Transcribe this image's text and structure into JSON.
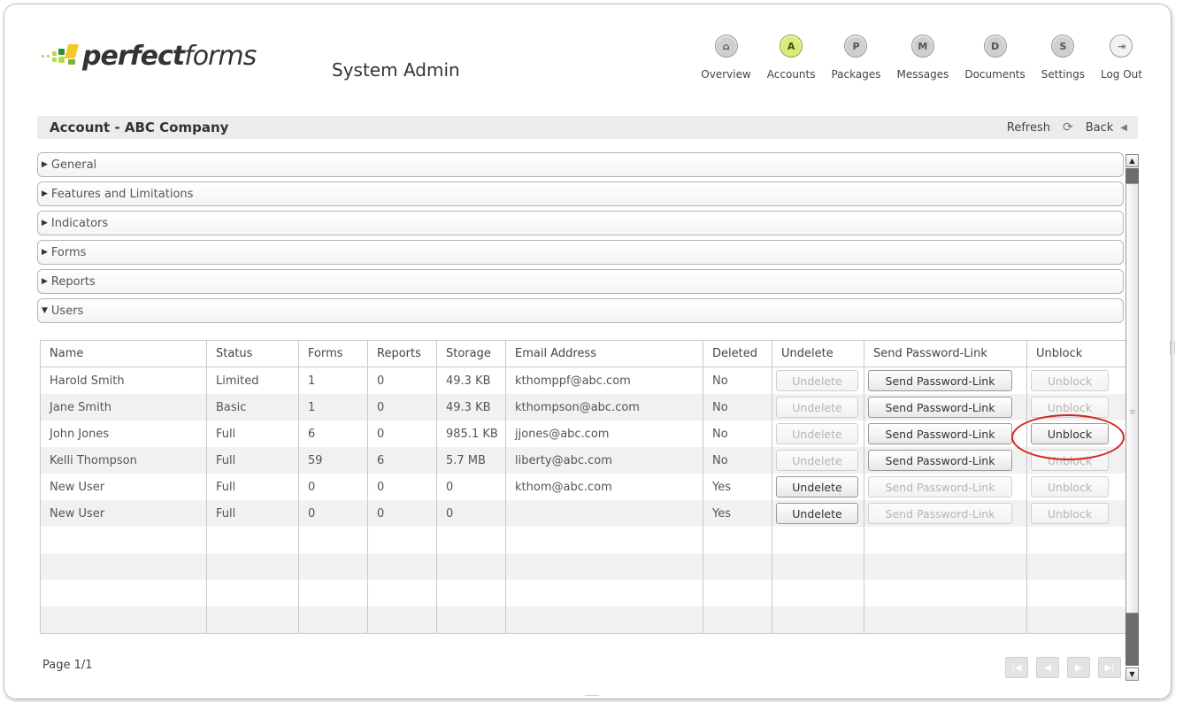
{
  "app": {
    "logo_bold": "perfect",
    "logo_light": "forms",
    "title": "System Admin"
  },
  "nav": [
    {
      "name": "overview",
      "glyph": "⌂",
      "label": "Overview",
      "active": false
    },
    {
      "name": "accounts",
      "glyph": "A",
      "label": "Accounts",
      "active": true
    },
    {
      "name": "packages",
      "glyph": "P",
      "label": "Packages",
      "active": false
    },
    {
      "name": "messages",
      "glyph": "M",
      "label": "Messages",
      "active": false
    },
    {
      "name": "documents",
      "glyph": "D",
      "label": "Documents",
      "active": false
    },
    {
      "name": "settings",
      "glyph": "S",
      "label": "Settings",
      "active": false
    },
    {
      "name": "logout",
      "glyph": "⇥",
      "label": "Log Out",
      "active": false
    }
  ],
  "account_bar": {
    "title": "Account - ABC Company",
    "refresh_label": "Refresh",
    "back_label": "Back"
  },
  "sections": [
    {
      "label": "General",
      "expanded": false
    },
    {
      "label": "Features and Limitations",
      "expanded": false
    },
    {
      "label": "Indicators",
      "expanded": false
    },
    {
      "label": "Forms",
      "expanded": false
    },
    {
      "label": "Reports",
      "expanded": false
    },
    {
      "label": "Users",
      "expanded": true
    }
  ],
  "users_table": {
    "columns": [
      "Name",
      "Status",
      "Forms",
      "Reports",
      "Storage",
      "Email Address",
      "Deleted",
      "Undelete",
      "Send Password-Link",
      "Unblock"
    ],
    "rows": [
      {
        "name": "Harold Smith",
        "status": "Limited",
        "forms": "1",
        "reports": "0",
        "storage": "49.3 KB",
        "email": "kthomppf@abc.com",
        "deleted": "No",
        "undelete": "Undelete",
        "undelete_enabled": false,
        "send_link": "Send Password-Link",
        "send_link_enabled": true,
        "unblock": "Unblock",
        "unblock_enabled": false
      },
      {
        "name": "Jane Smith",
        "status": "Basic",
        "forms": "1",
        "reports": "0",
        "storage": "49.3 KB",
        "email": "kthompson@abc.com",
        "deleted": "No",
        "undelete": "Undelete",
        "undelete_enabled": false,
        "send_link": "Send Password-Link",
        "send_link_enabled": true,
        "unblock": "Unblock",
        "unblock_enabled": false
      },
      {
        "name": "John Jones",
        "status": "Full",
        "forms": "6",
        "reports": "0",
        "storage": "985.1 KB",
        "email": "jjones@abc.com",
        "deleted": "No",
        "undelete": "Undelete",
        "undelete_enabled": false,
        "send_link": "Send Password-Link",
        "send_link_enabled": true,
        "unblock": "Unblock",
        "unblock_enabled": true
      },
      {
        "name": "Kelli Thompson",
        "status": "Full",
        "forms": "59",
        "reports": "6",
        "storage": "5.7 MB",
        "email": "liberty@abc.com",
        "deleted": "No",
        "undelete": "Undelete",
        "undelete_enabled": false,
        "send_link": "Send Password-Link",
        "send_link_enabled": true,
        "unblock": "Unblock",
        "unblock_enabled": false
      },
      {
        "name": "New User",
        "status": "Full",
        "forms": "0",
        "reports": "0",
        "storage": "0",
        "email": "kthom@abc.com",
        "deleted": "Yes",
        "undelete": "Undelete",
        "undelete_enabled": true,
        "send_link": "Send Password-Link",
        "send_link_enabled": false,
        "unblock": "Unblock",
        "unblock_enabled": false
      },
      {
        "name": "New User",
        "status": "Full",
        "forms": "0",
        "reports": "0",
        "storage": "0",
        "email": "",
        "deleted": "Yes",
        "undelete": "Undelete",
        "undelete_enabled": true,
        "send_link": "Send Password-Link",
        "send_link_enabled": false,
        "unblock": "Unblock",
        "unblock_enabled": false
      }
    ],
    "empty_rows": 4
  },
  "footer": {
    "page_info": "Page 1/1"
  },
  "colors": {
    "accent_active": "#d8ec7a",
    "highlight_ring": "#d2271d",
    "logo_green": "#b9d84a"
  }
}
